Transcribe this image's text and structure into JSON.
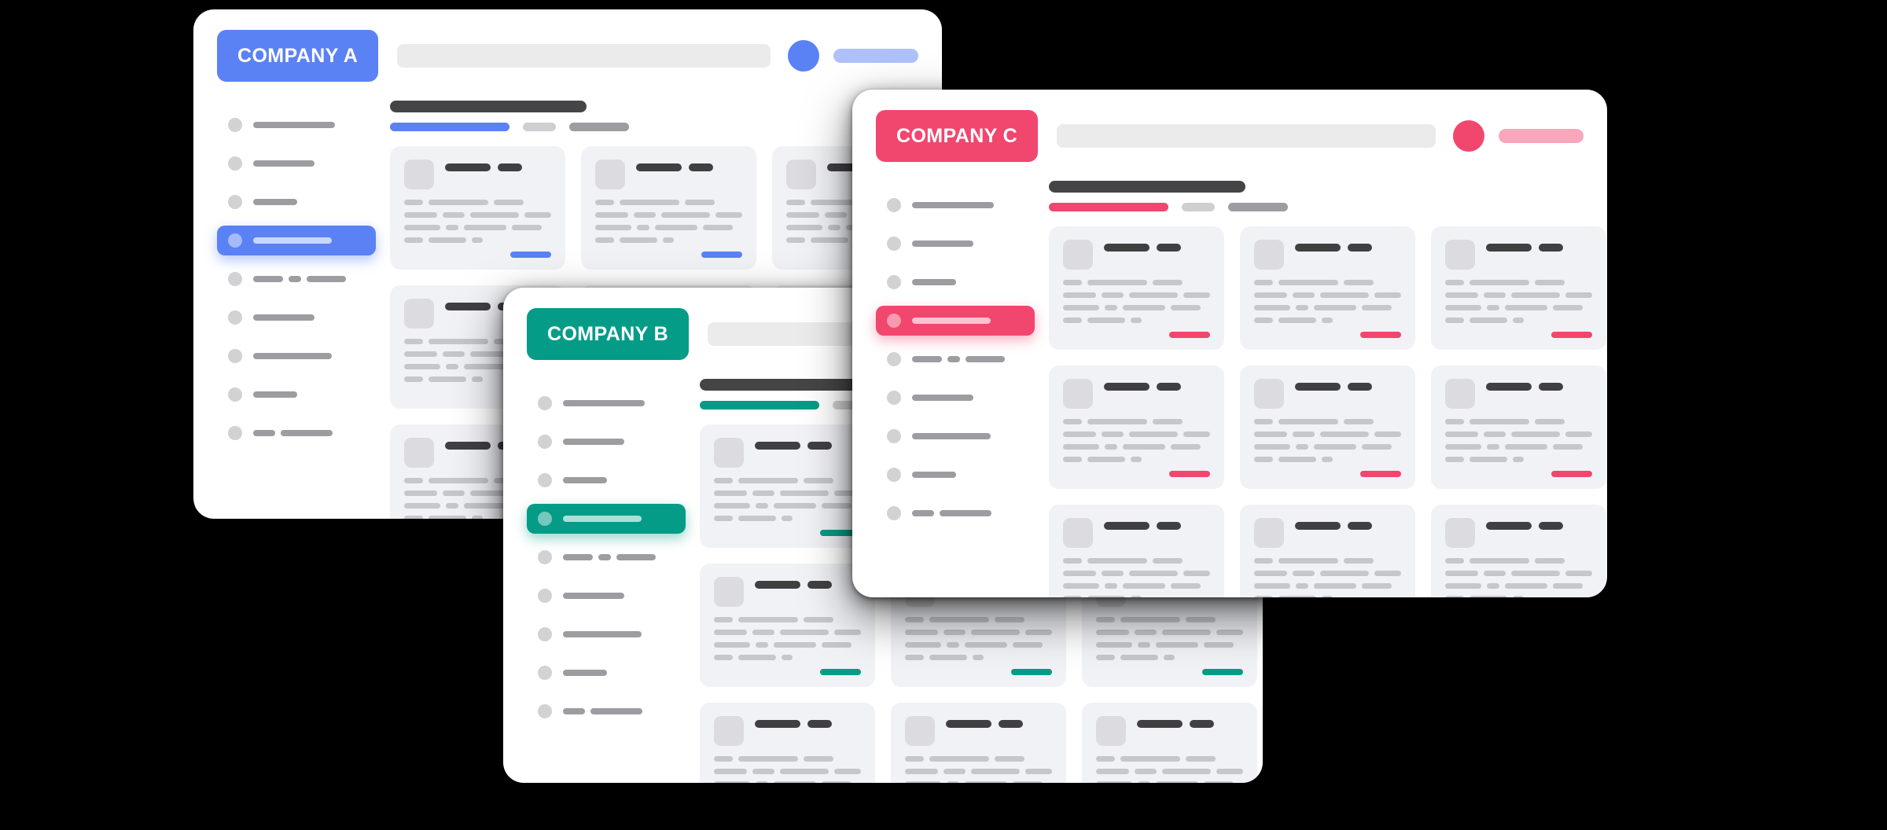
{
  "windows": [
    {
      "id": "win-a",
      "brand_label": "COMPANY A",
      "accent": "#5A82F5",
      "accent_soft": "#AEC1FA",
      "search_placeholder": "",
      "nav": {
        "active_index": 3,
        "items": [
          {
            "icon": "nav-dot-icon",
            "segments": [
              104
            ]
          },
          {
            "icon": "nav-dot-icon",
            "segments": [
              78
            ]
          },
          {
            "icon": "nav-dot-icon",
            "segments": [
              56
            ]
          },
          {
            "icon": "nav-dot-icon",
            "segments": [
              100
            ]
          },
          {
            "icon": "nav-dot-icon",
            "segments": [
              38,
              16,
              50
            ]
          },
          {
            "icon": "nav-dot-icon",
            "segments": [
              78
            ]
          },
          {
            "icon": "nav-dot-icon",
            "segments": [
              100
            ]
          },
          {
            "icon": "nav-dot-icon",
            "segments": [
              56
            ]
          },
          {
            "icon": "nav-dot-icon",
            "segments": [
              28,
              66
            ]
          }
        ]
      },
      "tabs": [
        {
          "label": "",
          "state": "active"
        },
        {
          "label": "",
          "state": "inactive"
        },
        {
          "label": "",
          "state": "inactive"
        }
      ],
      "cards": [
        {
          "title_a": "",
          "title_b": "",
          "lines": [
            [
              24,
              76,
              38
            ],
            [
              42,
              28,
              62,
              34
            ],
            [
              46,
              16,
              54,
              38
            ],
            [
              24,
              48,
              14
            ]
          ]
        },
        {
          "title_a": "",
          "title_b": "",
          "lines": [
            [
              24,
              76,
              38
            ],
            [
              42,
              28,
              62,
              34
            ],
            [
              46,
              16,
              54,
              38
            ],
            [
              24,
              48,
              14
            ]
          ]
        },
        {
          "title_a": "",
          "title_b": "",
          "lines": [
            [
              24,
              76,
              38
            ],
            [
              42,
              28,
              62,
              34
            ],
            [
              46,
              16,
              54,
              38
            ],
            [
              24,
              48,
              14
            ]
          ]
        },
        {
          "title_a": "",
          "title_b": "",
          "lines": [
            [
              24,
              76,
              38
            ],
            [
              42,
              28,
              62,
              34
            ],
            [
              46,
              16,
              54,
              38
            ],
            [
              24,
              48,
              14
            ]
          ]
        },
        {
          "title_a": "",
          "title_b": "",
          "lines": [
            [
              24,
              76,
              38
            ],
            [
              42,
              28,
              62,
              34
            ],
            [
              46,
              16,
              54,
              38
            ],
            [
              24,
              48,
              14
            ]
          ]
        },
        {
          "title_a": "",
          "title_b": "",
          "lines": [
            [
              24,
              76,
              38
            ],
            [
              42,
              28,
              62,
              34
            ],
            [
              46,
              16,
              54,
              38
            ],
            [
              24,
              48,
              14
            ]
          ]
        },
        {
          "title_a": "",
          "title_b": "",
          "lines": [
            [
              24,
              76,
              38
            ],
            [
              42,
              28,
              62,
              34
            ],
            [
              46,
              16,
              54,
              38
            ],
            [
              24,
              48,
              14
            ]
          ]
        },
        {
          "title_a": "",
          "title_b": "",
          "lines": [
            [
              24,
              76,
              38
            ],
            [
              42,
              28,
              62,
              34
            ],
            [
              46,
              16,
              54,
              38
            ],
            [
              24,
              48,
              14
            ]
          ]
        },
        {
          "title_a": "",
          "title_b": "",
          "lines": [
            [
              24,
              76,
              38
            ],
            [
              42,
              28,
              62,
              34
            ],
            [
              46,
              16,
              54,
              38
            ],
            [
              24,
              48,
              14
            ]
          ]
        }
      ]
    },
    {
      "id": "win-b",
      "brand_label": "COMPANY B",
      "accent": "#059C87",
      "accent_soft": "#86CCC2",
      "search_placeholder": "",
      "nav": {
        "active_index": 3,
        "items": [
          {
            "icon": "nav-dot-icon",
            "segments": [
              104
            ]
          },
          {
            "icon": "nav-dot-icon",
            "segments": [
              78
            ]
          },
          {
            "icon": "nav-dot-icon",
            "segments": [
              56
            ]
          },
          {
            "icon": "nav-dot-icon",
            "segments": [
              100
            ]
          },
          {
            "icon": "nav-dot-icon",
            "segments": [
              38,
              16,
              50
            ]
          },
          {
            "icon": "nav-dot-icon",
            "segments": [
              78
            ]
          },
          {
            "icon": "nav-dot-icon",
            "segments": [
              100
            ]
          },
          {
            "icon": "nav-dot-icon",
            "segments": [
              56
            ]
          },
          {
            "icon": "nav-dot-icon",
            "segments": [
              28,
              66
            ]
          }
        ]
      },
      "tabs": [
        {
          "label": "",
          "state": "active"
        },
        {
          "label": "",
          "state": "inactive"
        },
        {
          "label": "",
          "state": "inactive"
        }
      ],
      "cards": [
        {
          "title_a": "",
          "title_b": "",
          "lines": [
            [
              24,
              76,
              38
            ],
            [
              42,
              28,
              62,
              34
            ],
            [
              46,
              16,
              54,
              38
            ],
            [
              24,
              48,
              14
            ]
          ]
        },
        {
          "title_a": "",
          "title_b": "",
          "lines": [
            [
              24,
              76,
              38
            ],
            [
              42,
              28,
              62,
              34
            ],
            [
              46,
              16,
              54,
              38
            ],
            [
              24,
              48,
              14
            ]
          ]
        },
        {
          "title_a": "",
          "title_b": "",
          "lines": [
            [
              24,
              76,
              38
            ],
            [
              42,
              28,
              62,
              34
            ],
            [
              46,
              16,
              54,
              38
            ],
            [
              24,
              48,
              14
            ]
          ]
        },
        {
          "title_a": "",
          "title_b": "",
          "lines": [
            [
              24,
              76,
              38
            ],
            [
              42,
              28,
              62,
              34
            ],
            [
              46,
              16,
              54,
              38
            ],
            [
              24,
              48,
              14
            ]
          ]
        },
        {
          "title_a": "",
          "title_b": "",
          "lines": [
            [
              24,
              76,
              38
            ],
            [
              42,
              28,
              62,
              34
            ],
            [
              46,
              16,
              54,
              38
            ],
            [
              24,
              48,
              14
            ]
          ]
        },
        {
          "title_a": "",
          "title_b": "",
          "lines": [
            [
              24,
              76,
              38
            ],
            [
              42,
              28,
              62,
              34
            ],
            [
              46,
              16,
              54,
              38
            ],
            [
              24,
              48,
              14
            ]
          ]
        },
        {
          "title_a": "",
          "title_b": "",
          "lines": [
            [
              24,
              76,
              38
            ],
            [
              42,
              28,
              62,
              34
            ],
            [
              46,
              16,
              54,
              38
            ],
            [
              24,
              48,
              14
            ]
          ]
        },
        {
          "title_a": "",
          "title_b": "",
          "lines": [
            [
              24,
              76,
              38
            ],
            [
              42,
              28,
              62,
              34
            ],
            [
              46,
              16,
              54,
              38
            ],
            [
              24,
              48,
              14
            ]
          ]
        },
        {
          "title_a": "",
          "title_b": "",
          "lines": [
            [
              24,
              76,
              38
            ],
            [
              42,
              28,
              62,
              34
            ],
            [
              46,
              16,
              54,
              38
            ],
            [
              24,
              48,
              14
            ]
          ]
        }
      ]
    },
    {
      "id": "win-c",
      "brand_label": "COMPANY C",
      "accent": "#F1466E",
      "accent_soft": "#F9A7BB",
      "search_placeholder": "",
      "nav": {
        "active_index": 3,
        "items": [
          {
            "icon": "nav-dot-icon",
            "segments": [
              104
            ]
          },
          {
            "icon": "nav-dot-icon",
            "segments": [
              78
            ]
          },
          {
            "icon": "nav-dot-icon",
            "segments": [
              56
            ]
          },
          {
            "icon": "nav-dot-icon",
            "segments": [
              100
            ]
          },
          {
            "icon": "nav-dot-icon",
            "segments": [
              38,
              16,
              50
            ]
          },
          {
            "icon": "nav-dot-icon",
            "segments": [
              78
            ]
          },
          {
            "icon": "nav-dot-icon",
            "segments": [
              100
            ]
          },
          {
            "icon": "nav-dot-icon",
            "segments": [
              56
            ]
          },
          {
            "icon": "nav-dot-icon",
            "segments": [
              28,
              66
            ]
          }
        ]
      },
      "tabs": [
        {
          "label": "",
          "state": "active"
        },
        {
          "label": "",
          "state": "inactive"
        },
        {
          "label": "",
          "state": "inactive"
        }
      ],
      "cards": [
        {
          "title_a": "",
          "title_b": "",
          "lines": [
            [
              24,
              76,
              38
            ],
            [
              42,
              28,
              62,
              34
            ],
            [
              46,
              16,
              54,
              38
            ],
            [
              24,
              48,
              14
            ]
          ]
        },
        {
          "title_a": "",
          "title_b": "",
          "lines": [
            [
              24,
              76,
              38
            ],
            [
              42,
              28,
              62,
              34
            ],
            [
              46,
              16,
              54,
              38
            ],
            [
              24,
              48,
              14
            ]
          ]
        },
        {
          "title_a": "",
          "title_b": "",
          "lines": [
            [
              24,
              76,
              38
            ],
            [
              42,
              28,
              62,
              34
            ],
            [
              46,
              16,
              54,
              38
            ],
            [
              24,
              48,
              14
            ]
          ]
        },
        {
          "title_a": "",
          "title_b": "",
          "lines": [
            [
              24,
              76,
              38
            ],
            [
              42,
              28,
              62,
              34
            ],
            [
              46,
              16,
              54,
              38
            ],
            [
              24,
              48,
              14
            ]
          ]
        },
        {
          "title_a": "",
          "title_b": "",
          "lines": [
            [
              24,
              76,
              38
            ],
            [
              42,
              28,
              62,
              34
            ],
            [
              46,
              16,
              54,
              38
            ],
            [
              24,
              48,
              14
            ]
          ]
        },
        {
          "title_a": "",
          "title_b": "",
          "lines": [
            [
              24,
              76,
              38
            ],
            [
              42,
              28,
              62,
              34
            ],
            [
              46,
              16,
              54,
              38
            ],
            [
              24,
              48,
              14
            ]
          ]
        },
        {
          "title_a": "",
          "title_b": "",
          "lines": [
            [
              24,
              76,
              38
            ],
            [
              42,
              28,
              62,
              34
            ],
            [
              46,
              16,
              54,
              38
            ],
            [
              24,
              48,
              14
            ]
          ]
        },
        {
          "title_a": "",
          "title_b": "",
          "lines": [
            [
              24,
              76,
              38
            ],
            [
              42,
              28,
              62,
              34
            ],
            [
              46,
              16,
              54,
              38
            ],
            [
              24,
              48,
              14
            ]
          ]
        },
        {
          "title_a": "",
          "title_b": "",
          "lines": [
            [
              24,
              76,
              38
            ],
            [
              42,
              28,
              62,
              34
            ],
            [
              46,
              16,
              54,
              38
            ],
            [
              24,
              48,
              14
            ]
          ]
        }
      ]
    }
  ]
}
